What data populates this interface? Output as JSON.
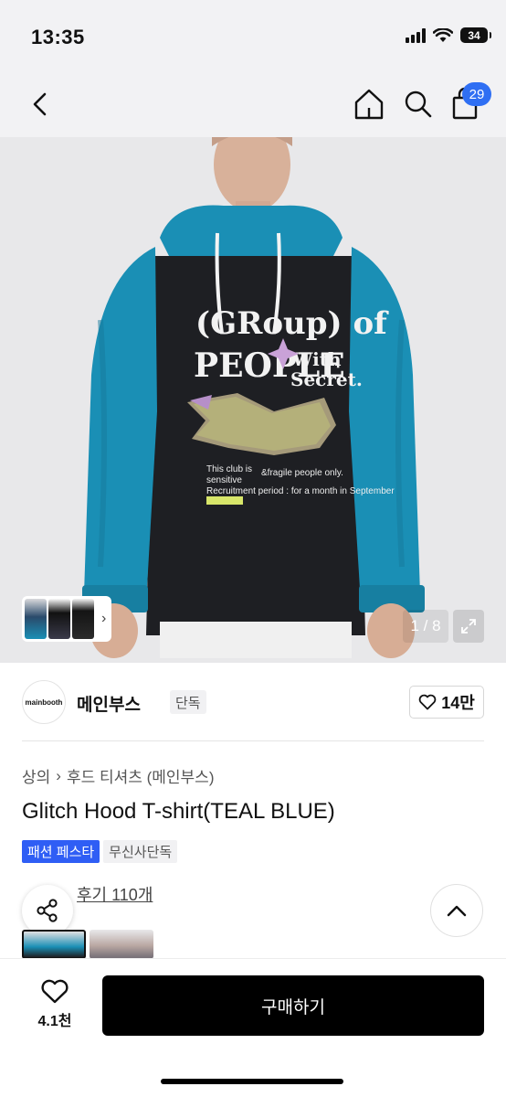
{
  "status_bar": {
    "time": "13:35",
    "battery": "34"
  },
  "nav": {
    "cart_count": "29"
  },
  "gallery": {
    "counter": "1 / 8"
  },
  "brand": {
    "logo_text": "mainbooth",
    "name": "메인부스",
    "tag": "단독",
    "likes": "14만"
  },
  "breadcrumb": {
    "items": [
      "상의",
      "후드 티셔츠 (메인부스)"
    ]
  },
  "product": {
    "title": "Glitch Hood T-shirt(TEAL BLUE)",
    "badges": [
      "패션 페스타",
      "무신사단독"
    ],
    "review_link": "후기 110개"
  },
  "bottom_bar": {
    "wish_count": "4.1천",
    "buy_label": "구매하기"
  },
  "colors": {
    "accent": "#2f6ff3",
    "badge_blue": "#2f5ef5",
    "teal": "#1a8fb5",
    "body_black": "#1e1f23"
  },
  "icons": [
    "back-icon",
    "home-icon",
    "search-icon",
    "cart-icon",
    "expand-icon",
    "heart-icon",
    "share-icon",
    "chevron-up-icon"
  ]
}
